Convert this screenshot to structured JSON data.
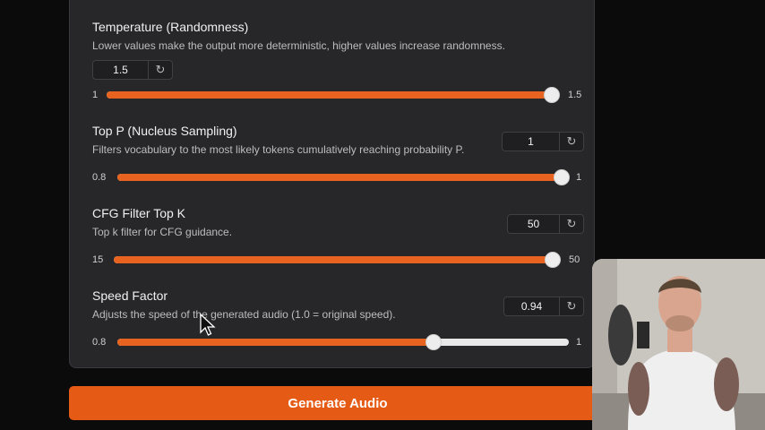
{
  "accent_color": "#e8631f",
  "params": [
    {
      "id": "temperature",
      "title": "Temperature (Randomness)",
      "description": "Lower values make the output more deterministic, higher values increase randomness.",
      "value": "1.5",
      "min_label": "1",
      "max_label": "1.5",
      "min": 1,
      "max": 1.5,
      "current": 1.5
    },
    {
      "id": "top_p",
      "title": "Top P (Nucleus Sampling)",
      "description": "Filters vocabulary to the most likely tokens cumulatively reaching probability P.",
      "value": "1",
      "min_label": "0.8",
      "max_label": "1",
      "min": 0.8,
      "max": 1,
      "current": 1
    },
    {
      "id": "cfg_top_k",
      "title": "CFG Filter Top K",
      "description": "Top k filter for CFG guidance.",
      "value": "50",
      "min_label": "15",
      "max_label": "50",
      "min": 15,
      "max": 50,
      "current": 50
    },
    {
      "id": "speed_factor",
      "title": "Speed Factor",
      "description": "Adjusts the speed of the generated audio (1.0 = original speed).",
      "value": "0.94",
      "min_label": "0.8",
      "max_label": "1",
      "min": 0.8,
      "max": 1,
      "current": 0.94
    }
  ],
  "reset_icon": "↻",
  "generate_button": "Generate Audio"
}
